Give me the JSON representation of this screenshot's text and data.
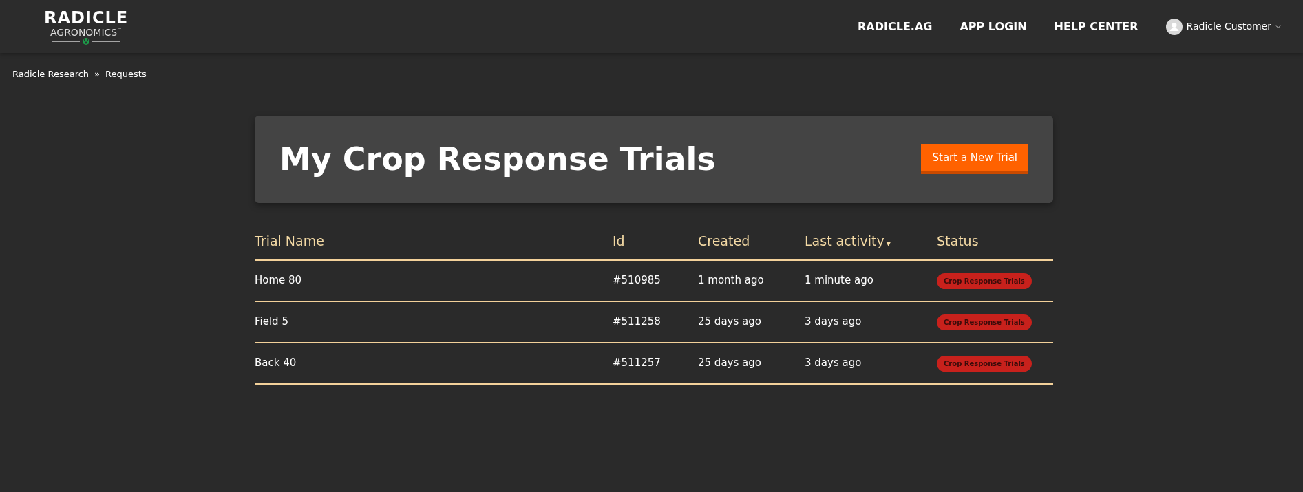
{
  "header": {
    "logo": {
      "name": "RADICLE",
      "subtitle": "AGRONOMICS",
      "trademark": "™"
    },
    "nav": [
      "RADICLE.AG",
      "APP LOGIN",
      "HELP CENTER"
    ],
    "user": {
      "name": "Radicle Customer"
    }
  },
  "breadcrumb": {
    "items": [
      "Radicle Research",
      "Requests"
    ],
    "separator": "»"
  },
  "banner": {
    "title": "My Crop Response Trials",
    "button": "Start a New Trial"
  },
  "table": {
    "sort_indicator": "▾",
    "columns": [
      {
        "label": "Trial Name",
        "sorted": false
      },
      {
        "label": "Id",
        "sorted": false
      },
      {
        "label": "Created",
        "sorted": false
      },
      {
        "label": "Last activity",
        "sorted": true
      },
      {
        "label": "Status",
        "sorted": false
      }
    ],
    "rows": [
      {
        "name": "Home 80",
        "id": "#510985",
        "created": "1 month ago",
        "last_activity": "1 minute ago",
        "status": "Crop Response Trials"
      },
      {
        "name": "Field 5",
        "id": "#511258",
        "created": "25 days ago",
        "last_activity": "3 days ago",
        "status": "Crop Response Trials"
      },
      {
        "name": "Back 40",
        "id": "#511257",
        "created": "25 days ago",
        "last_activity": "3 days ago",
        "status": "Crop Response Trials"
      }
    ]
  }
}
